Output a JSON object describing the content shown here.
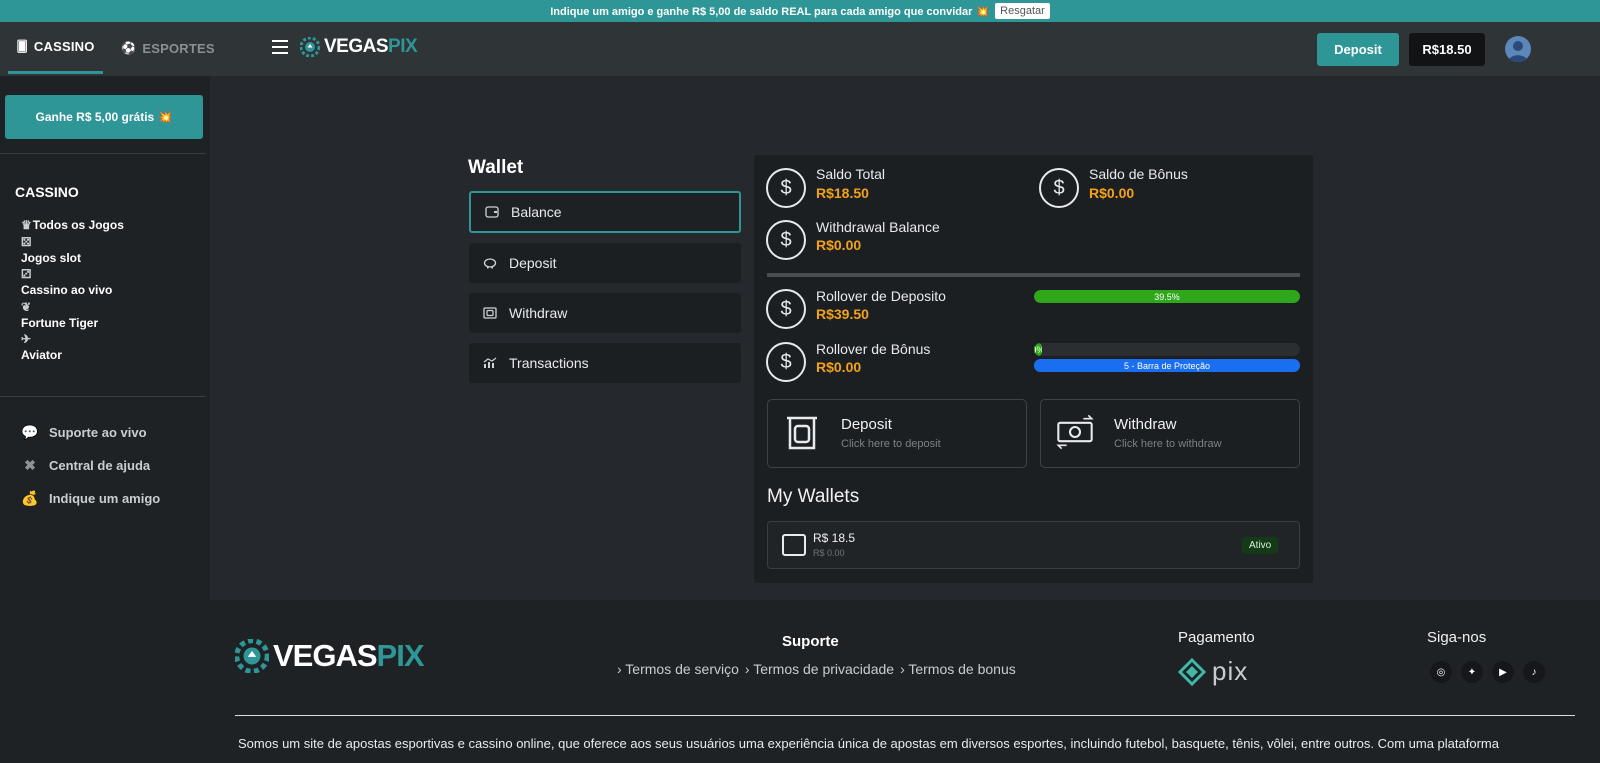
{
  "promo": {
    "text": "Indique um amigo e ganhe R$ 5,00 de saldo REAL para cada amigo que convidar 💥",
    "button": "Resgatar"
  },
  "header": {
    "tabs": [
      {
        "label": "CASSINO",
        "icon": "card-icon",
        "active": true
      },
      {
        "label": "ESPORTES",
        "icon": "ball-icon",
        "active": false
      }
    ],
    "logo": {
      "part1": "VEGAS",
      "part2": "PIX"
    },
    "deposit_label": "Deposit",
    "balance": "R$18.50"
  },
  "sidebar": {
    "free_button": "Ganhe R$ 5,00 grátis 💥",
    "section_title": "CASSINO",
    "games": [
      {
        "label": "Todos os Jogos",
        "icon": "crown-icon"
      },
      {
        "label": "Jogos slot",
        "icon": "dice-icon"
      },
      {
        "label": "Cassino ao vivo",
        "icon": "dice-icon"
      },
      {
        "label": "Fortune Tiger",
        "icon": "paw-icon"
      },
      {
        "label": "Aviator",
        "icon": "plane-icon"
      }
    ],
    "links": [
      {
        "label": "Suporte ao vivo",
        "icon": "chat-icon"
      },
      {
        "label": "Central de ajuda",
        "icon": "lifebuoy-icon"
      },
      {
        "label": "Indique um amigo",
        "icon": "money-bag-icon"
      }
    ]
  },
  "wallet": {
    "title": "Wallet",
    "nav": [
      {
        "label": "Balance",
        "icon": "wallet-icon",
        "active": true
      },
      {
        "label": "Deposit",
        "icon": "piggy-bank-icon",
        "active": false
      },
      {
        "label": "Withdraw",
        "icon": "cash-icon",
        "active": false
      },
      {
        "label": "Transactions",
        "icon": "chart-icon",
        "active": false
      }
    ],
    "balances": {
      "total": {
        "label": "Saldo Total",
        "value": "R$18.50"
      },
      "bonus": {
        "label": "Saldo de Bônus",
        "value": "R$0.00"
      },
      "withdrawal": {
        "label": "Withdrawal Balance",
        "value": "R$0.00"
      }
    },
    "rollover": {
      "deposit": {
        "label": "Rollover de Deposito",
        "value": "R$39.50",
        "progress_text": "39.5%",
        "progress_percent": 100
      },
      "bonus": {
        "label": "Rollover de Bônus",
        "value": "R$0.00",
        "progress_text": "0%",
        "progress_percent": 3,
        "protection_text": "5 - Barra de Proteção"
      }
    },
    "cards": {
      "deposit": {
        "title": "Deposit",
        "subtitle": "Click here to deposit"
      },
      "withdraw": {
        "title": "Withdraw",
        "subtitle": "Click here to withdraw"
      }
    },
    "my_wallets": {
      "title": "My Wallets",
      "items": [
        {
          "amount": "R$ 18.5",
          "sub": "R$ 0.00",
          "status": "Ativo"
        }
      ]
    }
  },
  "footer": {
    "logo": {
      "part1": "VEGAS",
      "part2": "PIX"
    },
    "suporte_title": "Suporte",
    "links": [
      "› Termos de serviço",
      "› Termos de privacidade",
      "› Termos de bonus"
    ],
    "pagamento_title": "Pagamento",
    "pix_label": "pix",
    "siga_title": "Siga-nos",
    "socials": [
      "instagram-icon",
      "twitter-icon",
      "youtube-icon",
      "tiktok-icon"
    ],
    "about": "Somos um site de apostas esportivas e cassino online, que oferece aos seus usuários uma experiência única de apostas em diversos esportes, incluindo futebol, basquete, tênis, vôlei, entre outros. Com uma plataforma"
  },
  "colors": {
    "accent": "#2e9696",
    "money": "#f2a21a",
    "progress_green": "#2ea81a",
    "progress_blue": "#1a6ef0"
  }
}
